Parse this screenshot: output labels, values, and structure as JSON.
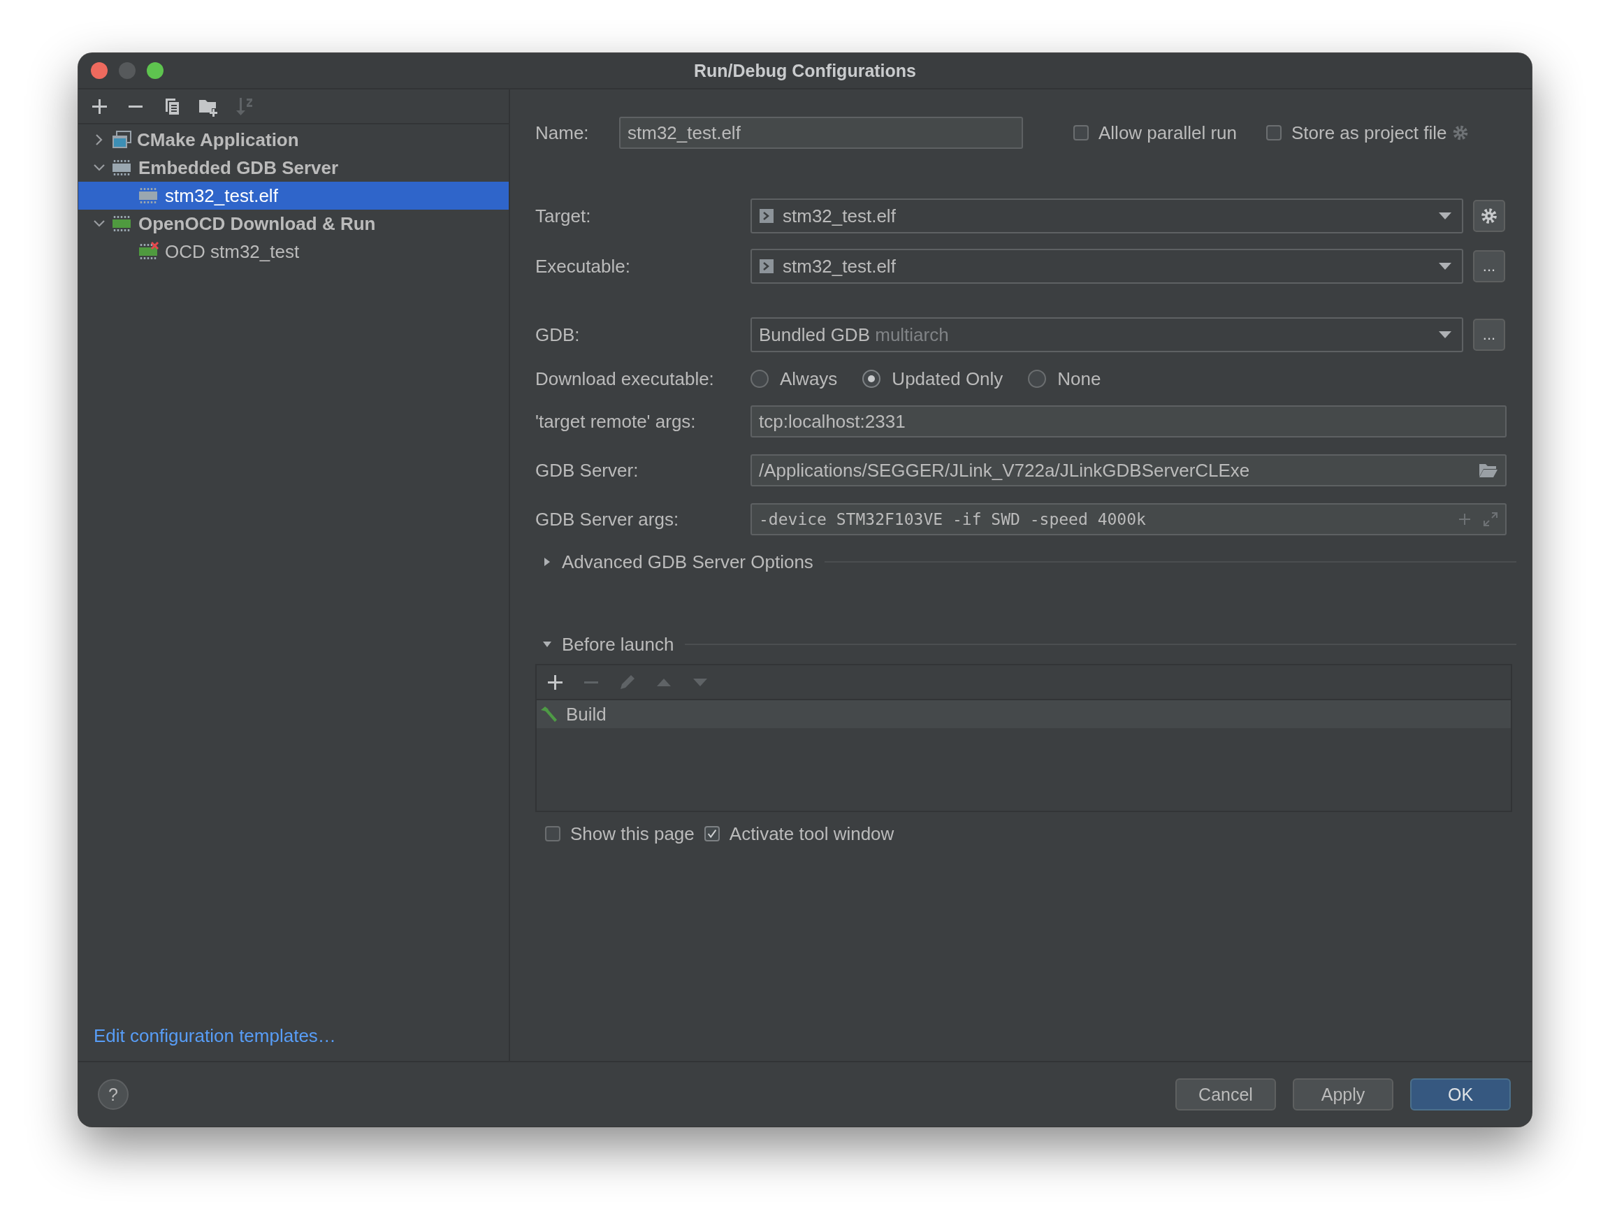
{
  "window": {
    "title": "Run/Debug Configurations"
  },
  "toolbar": [
    {
      "kind": "add",
      "disabled": false
    },
    {
      "kind": "remove",
      "disabled": false
    },
    {
      "kind": "copy",
      "disabled": false
    },
    {
      "kind": "new-folder",
      "disabled": false
    },
    {
      "kind": "sort",
      "disabled": true
    }
  ],
  "tree": [
    {
      "label": "CMake Application",
      "kind": "cmake",
      "expanded": false,
      "selected": false
    },
    {
      "label": "Embedded GDB Server",
      "kind": "chip",
      "expanded": true,
      "selected": false,
      "children": [
        {
          "label": "stm32_test.elf",
          "kind": "chip",
          "selected": true
        }
      ]
    },
    {
      "label": "OpenOCD Download & Run",
      "kind": "chip-green",
      "expanded": true,
      "selected": false,
      "children": [
        {
          "label": "OCD stm32_test",
          "kind": "chip-green-error",
          "selected": false
        }
      ]
    }
  ],
  "edit_templates_link": "Edit configuration templates…",
  "form": {
    "name": {
      "label": "Name:",
      "value": "stm32_test.elf"
    },
    "allow_parallel_run": {
      "label": "Allow parallel run",
      "checked": false
    },
    "store_as_project_file": {
      "label": "Store as project file",
      "checked": false
    },
    "target": {
      "label": "Target:",
      "value": "stm32_test.elf"
    },
    "executable": {
      "label": "Executable:",
      "value": "stm32_test.elf",
      "button": "..."
    },
    "gdb": {
      "label": "GDB:",
      "value": "Bundled GDB",
      "hint": "multiarch",
      "button": "..."
    },
    "download_executable": {
      "label": "Download executable:",
      "options": [
        {
          "label": "Always",
          "selected": false
        },
        {
          "label": "Updated Only",
          "selected": true
        },
        {
          "label": "None",
          "selected": false
        }
      ]
    },
    "target_remote_args": {
      "label": "'target remote' args:",
      "value": "tcp:localhost:2331"
    },
    "gdb_server": {
      "label": "GDB Server:",
      "value": "/Applications/SEGGER/JLink_V722a/JLinkGDBServerCLExe"
    },
    "gdb_server_args": {
      "label": "GDB Server args:",
      "value": "-device STM32F103VE -if SWD -speed 4000k"
    },
    "advanced": {
      "label": "Advanced GDB Server Options",
      "expanded": false
    },
    "before_launch": {
      "label": "Before launch",
      "expanded": true,
      "toolbar": [
        {
          "kind": "add",
          "disabled": false
        },
        {
          "kind": "remove",
          "disabled": true
        },
        {
          "kind": "edit",
          "disabled": true
        },
        {
          "kind": "up",
          "disabled": true
        },
        {
          "kind": "down",
          "disabled": true
        }
      ],
      "tasks": [
        {
          "label": "Build",
          "selected": true
        }
      ]
    },
    "show_this_page": {
      "label": "Show this page",
      "checked": false
    },
    "activate_tool_window": {
      "label": "Activate tool window",
      "checked": true
    }
  },
  "footer": {
    "help": "?",
    "buttons": [
      {
        "label": "Cancel",
        "kind": "secondary"
      },
      {
        "label": "Apply",
        "kind": "secondary"
      },
      {
        "label": "OK",
        "kind": "primary"
      }
    ]
  }
}
